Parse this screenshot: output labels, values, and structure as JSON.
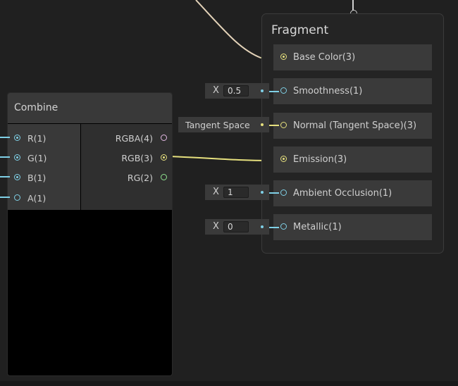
{
  "fragment": {
    "title": "Fragment",
    "slots": [
      {
        "label": "Base Color(3)"
      },
      {
        "label": "Smoothness(1)"
      },
      {
        "label": "Normal (Tangent Space)(3)"
      },
      {
        "label": "Emission(3)"
      },
      {
        "label": "Ambient Occlusion(1)"
      },
      {
        "label": "Metallic(1)"
      }
    ]
  },
  "inline_inputs": {
    "smoothness": {
      "axis": "X",
      "value": "0.5"
    },
    "normal_space": "Tangent Space",
    "ambient_occlusion": {
      "axis": "X",
      "value": "1"
    },
    "metallic": {
      "axis": "X",
      "value": "0"
    }
  },
  "combine": {
    "title": "Combine",
    "inputs": [
      "R(1)",
      "G(1)",
      "B(1)",
      "A(1)"
    ],
    "outputs": [
      "RGBA(4)",
      "RGB(3)",
      "RG(2)"
    ]
  },
  "colors": {
    "vector1_port": "#7fd0e6",
    "vector3_port": "#e6e07e",
    "vector4_port": "#e4b8e4",
    "vector2_port": "#8fe38f"
  }
}
